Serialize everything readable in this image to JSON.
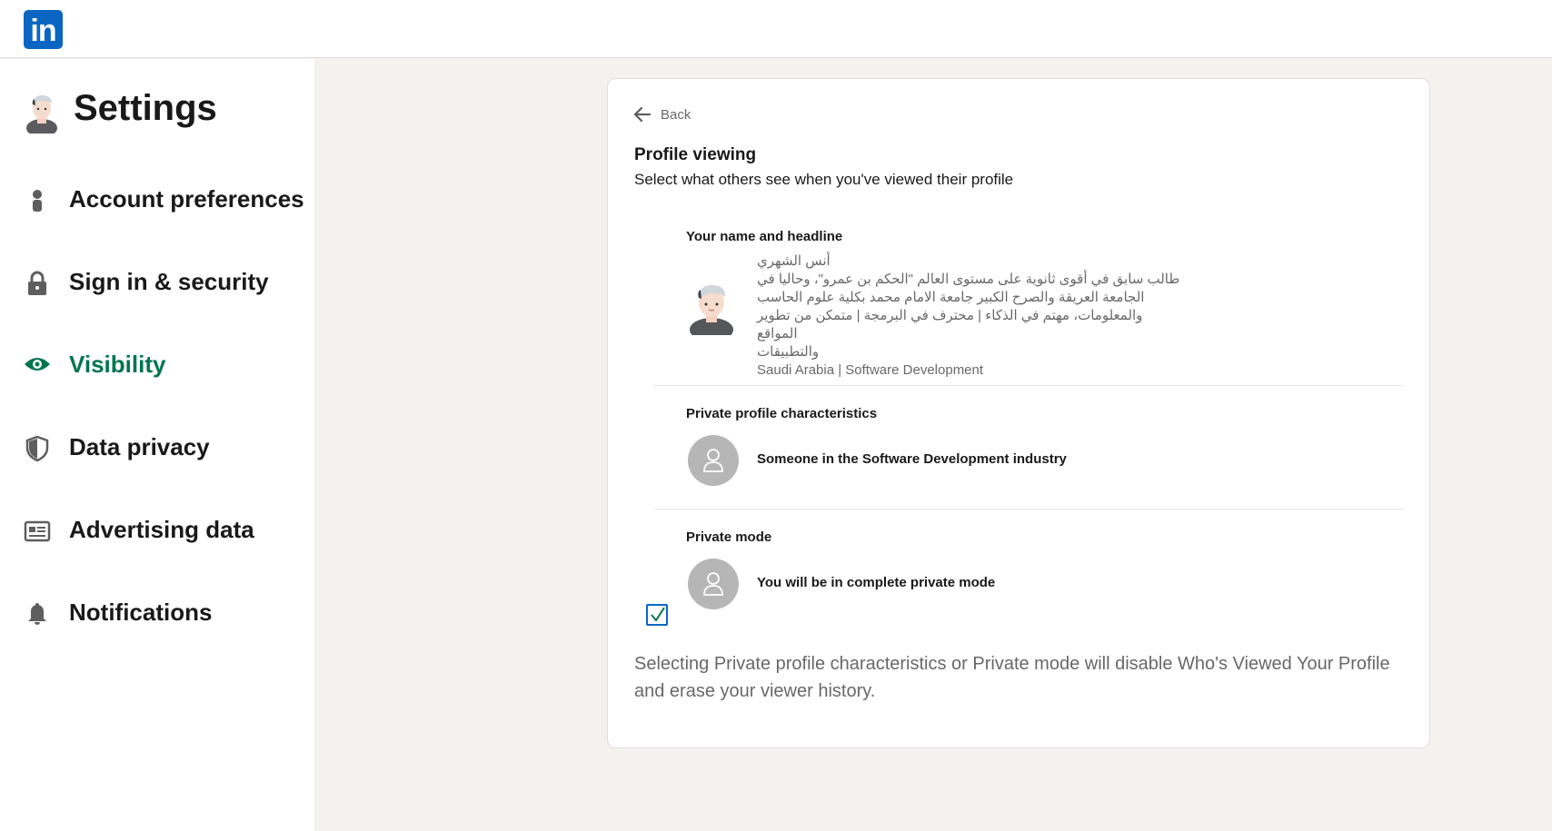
{
  "header": {
    "logo_text": "in"
  },
  "sidebar": {
    "title": "Settings",
    "items": [
      {
        "label": "Account preferences",
        "icon": "person-icon",
        "active": false
      },
      {
        "label": "Sign in & security",
        "icon": "lock-icon",
        "active": false
      },
      {
        "label": "Visibility",
        "icon": "eye-icon",
        "active": true
      },
      {
        "label": "Data privacy",
        "icon": "shield-icon",
        "active": false
      },
      {
        "label": "Advertising data",
        "icon": "newspaper-icon",
        "active": false
      },
      {
        "label": "Notifications",
        "icon": "bell-icon",
        "active": false
      }
    ]
  },
  "main": {
    "back_label": "Back",
    "title": "Profile viewing",
    "subtitle": "Select what others see when you've viewed their profile",
    "options": [
      {
        "label": "Your name and headline",
        "name": "أنس الشهري",
        "headline": "طالب سابق في أقوى ثانوية على مستوى العالم \"الحكم بن عمرو\"، وحاليا في\nالجامعة العريقة والصرح الكبير جامعة الامام محمد بكلية علوم الحاسب\nوالمعلومات، مهتم في الذكاء | محترف في البرمجة | متمكن من تطوير المواقع\nوالتطبيقات",
        "location": "Saudi Arabia | Software Development"
      },
      {
        "label": "Private profile characteristics",
        "description": "Someone in the Software Development industry"
      },
      {
        "label": "Private mode",
        "description": "You will be in complete private mode",
        "checked": true
      }
    ],
    "footnote": "Selecting Private profile characteristics or Private mode will disable Who's Viewed Your Profile and erase your viewer history."
  },
  "colors": {
    "brand": "#0a66c2",
    "active_nav": "#01754f",
    "page_bg": "#f4f2ee"
  }
}
